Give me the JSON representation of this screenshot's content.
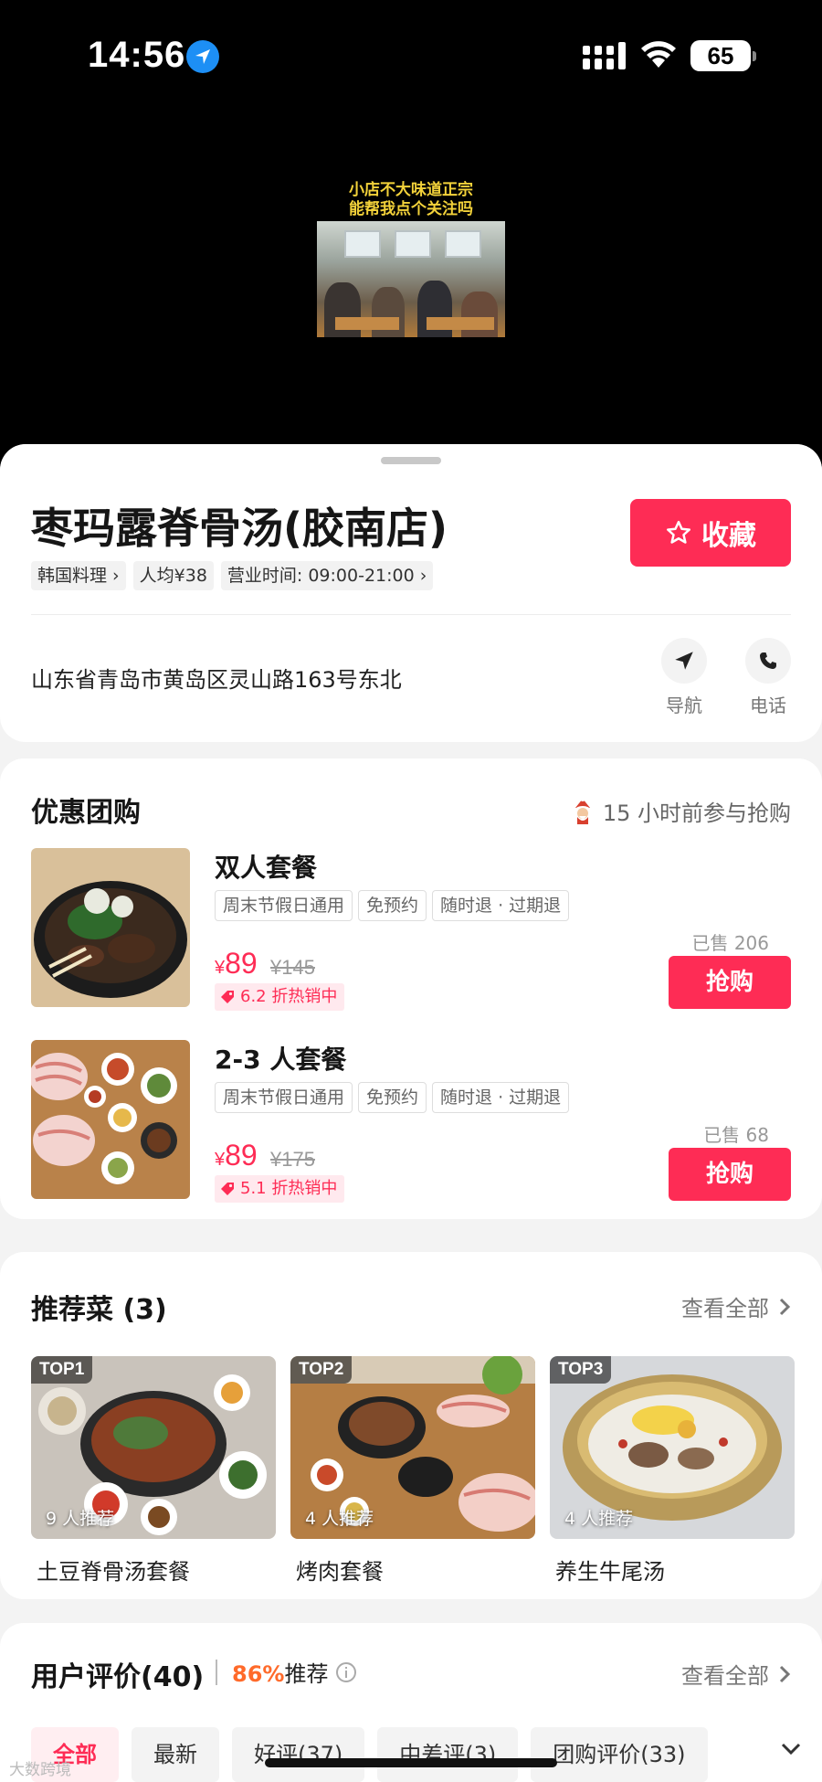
{
  "status": {
    "time": "14:56",
    "battery": "65"
  },
  "video": {
    "caption_line1": "小店不大味道正宗",
    "caption_line2": "能帮我点个关注吗"
  },
  "shop": {
    "name": "枣玛露脊骨汤(胶南店)",
    "favorite_label": "收藏",
    "tags": [
      "韩国料理 ›",
      "人均¥38",
      "营业时间: 09:00-21:00 ›"
    ],
    "address": "山东省青岛市黄岛区灵山路163号东北",
    "nav_label": "导航",
    "phone_label": "电话"
  },
  "deals": {
    "title": "优惠团购",
    "note": "15 小时前参与抢购",
    "items": [
      {
        "name": "双人套餐",
        "tags": [
          "周末节假日通用",
          "免预约",
          "随时退 · 过期退"
        ],
        "currency": "¥",
        "price": "89",
        "original": "¥145",
        "discount": "6.2 折热销中",
        "sold": "已售 206",
        "buy_label": "抢购"
      },
      {
        "name": "2-3 人套餐",
        "tags": [
          "周末节假日通用",
          "免预约",
          "随时退 · 过期退"
        ],
        "currency": "¥",
        "price": "89",
        "original": "¥175",
        "discount": "5.1 折热销中",
        "sold": "已售 68",
        "buy_label": "抢购"
      }
    ]
  },
  "recommended": {
    "title": "推荐菜 (3)",
    "see_all": "查看全部",
    "dishes": [
      {
        "rank": "TOP1",
        "count": "9 人推荐",
        "name": "土豆脊骨汤套餐"
      },
      {
        "rank": "TOP2",
        "count": "4 人推荐",
        "name": "烤肉套餐"
      },
      {
        "rank": "TOP3",
        "count": "4 人推荐",
        "name": "养生牛尾汤"
      }
    ]
  },
  "reviews": {
    "title": "用户评价(40)",
    "percent": "86%",
    "percent_suffix": "推荐",
    "see_all": "查看全部",
    "tabs": [
      "全部",
      "最新",
      "好评(37)",
      "中差评(3)",
      "团购评价(33)"
    ]
  },
  "watermark": "大数跨境",
  "colors": {
    "accent": "#fe2c55",
    "orange": "#ff6a2a"
  }
}
